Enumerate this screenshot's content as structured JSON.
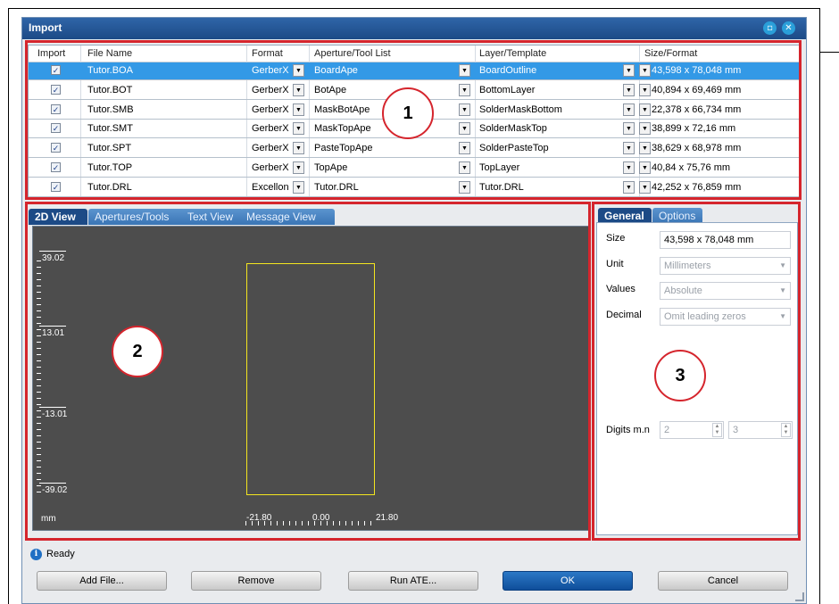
{
  "window": {
    "title": "Import"
  },
  "table": {
    "headers": [
      "Import",
      "File Name",
      "Format",
      "Aperture/Tool List",
      "Layer/Template",
      "Size/Format"
    ],
    "rows": [
      {
        "checked": true,
        "file": "Tutor.BOA",
        "format": "GerberX",
        "aperture": "BoardApe",
        "layer": "BoardOutline",
        "size": "43,598 x 78,048 mm",
        "selected": true
      },
      {
        "checked": true,
        "file": "Tutor.BOT",
        "format": "GerberX",
        "aperture": "BotApe",
        "layer": "BottomLayer",
        "size": "40,894 x 69,469 mm",
        "selected": false
      },
      {
        "checked": true,
        "file": "Tutor.SMB",
        "format": "GerberX",
        "aperture": "MaskBotApe",
        "layer": "SolderMaskBottom",
        "size": "22,378 x 66,734 mm",
        "selected": false
      },
      {
        "checked": true,
        "file": "Tutor.SMT",
        "format": "GerberX",
        "aperture": "MaskTopApe",
        "layer": "SolderMaskTop",
        "size": "38,899 x 72,16 mm",
        "selected": false
      },
      {
        "checked": true,
        "file": "Tutor.SPT",
        "format": "GerberX",
        "aperture": "PasteTopApe",
        "layer": "SolderPasteTop",
        "size": "38,629 x 68,978 mm",
        "selected": false
      },
      {
        "checked": true,
        "file": "Tutor.TOP",
        "format": "GerberX",
        "aperture": "TopApe",
        "layer": "TopLayer",
        "size": "40,84 x 75,76 mm",
        "selected": false
      },
      {
        "checked": true,
        "file": "Tutor.DRL",
        "format": "Excellon",
        "aperture": "Tutor.DRL",
        "layer": "Tutor.DRL",
        "size": "42,252 x 76,859 mm",
        "selected": false
      }
    ]
  },
  "callouts": {
    "c1": "1",
    "c2": "2",
    "c3": "3"
  },
  "view_tabs": [
    "2D View",
    "Apertures/Tools",
    "Text View",
    "Message View"
  ],
  "view": {
    "y_labels": [
      "39.02",
      "13.01",
      "-13.01",
      "-39.02"
    ],
    "x_labels": [
      "-21.80",
      "0.00",
      "21.80"
    ],
    "unit": "mm"
  },
  "panel_tabs": [
    "General",
    "Options"
  ],
  "panel": {
    "size_label": "Size",
    "size_value": "43,598 x 78,048 mm",
    "unit_label": "Unit",
    "unit_value": "Millimeters",
    "values_label": "Values",
    "values_value": "Absolute",
    "decimal_label": "Decimal",
    "decimal_value": "Omit leading zeros",
    "digits_label": "Digits m.n",
    "digits_m": "2",
    "digits_n": "3"
  },
  "status": {
    "text": "Ready"
  },
  "buttons": {
    "add": "Add File...",
    "remove": "Remove",
    "run": "Run ATE...",
    "ok": "OK",
    "cancel": "Cancel"
  },
  "colors": {
    "selection": "#3399e6",
    "callout_border": "#d5252d",
    "board_outline": "#f4e61f",
    "title_bar": "#1c4a86"
  }
}
